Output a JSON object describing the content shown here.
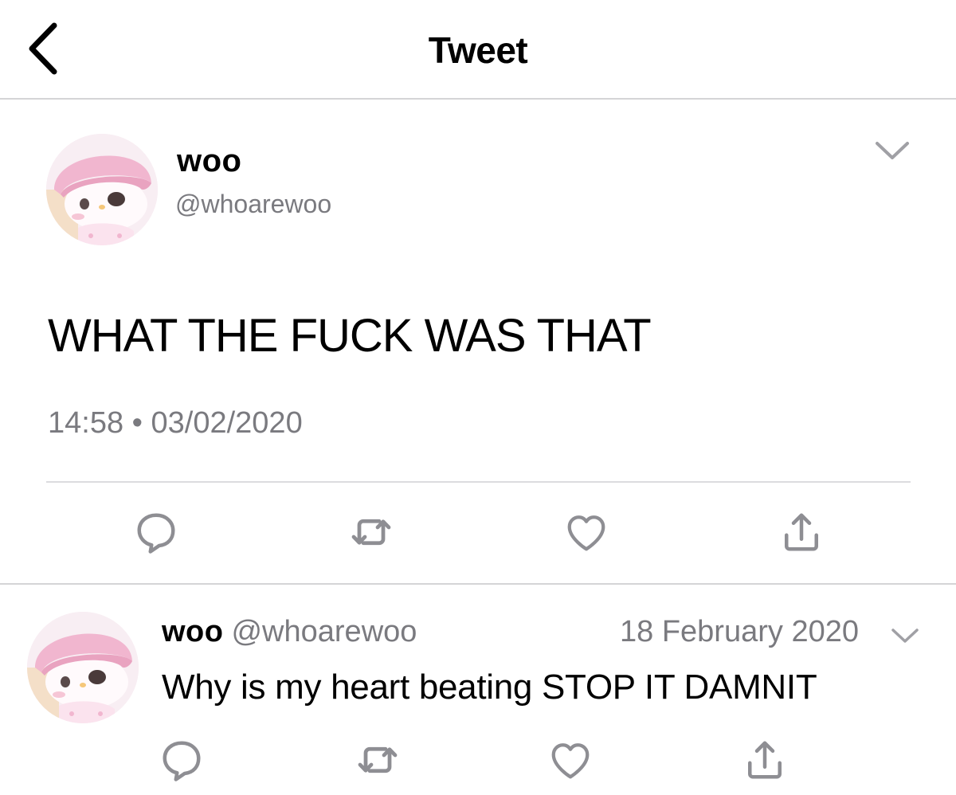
{
  "header": {
    "title": "Tweet",
    "back_icon": "chevron-left-icon"
  },
  "tweet": {
    "author_name": "woo",
    "author_handle": "@whoarewoo",
    "text": "WHAT THE FUCK WAS THAT",
    "timestamp": "14:58 • 03/02/2020",
    "actions": [
      "reply-icon",
      "retweet-icon",
      "like-icon",
      "share-icon"
    ]
  },
  "reply": {
    "author_name": "woo",
    "author_handle": "@whoarewoo",
    "date": "18 February 2020",
    "text": "Why is my heart beating STOP IT DAMNIT",
    "actions": [
      "reply-icon",
      "retweet-icon",
      "like-icon",
      "share-icon"
    ]
  },
  "colors": {
    "text": "#000000",
    "secondary": "#7a7a7f",
    "icon": "#8e8e93",
    "divider": "#d4d4d6",
    "avatar_pink": "#f1b6cf"
  }
}
